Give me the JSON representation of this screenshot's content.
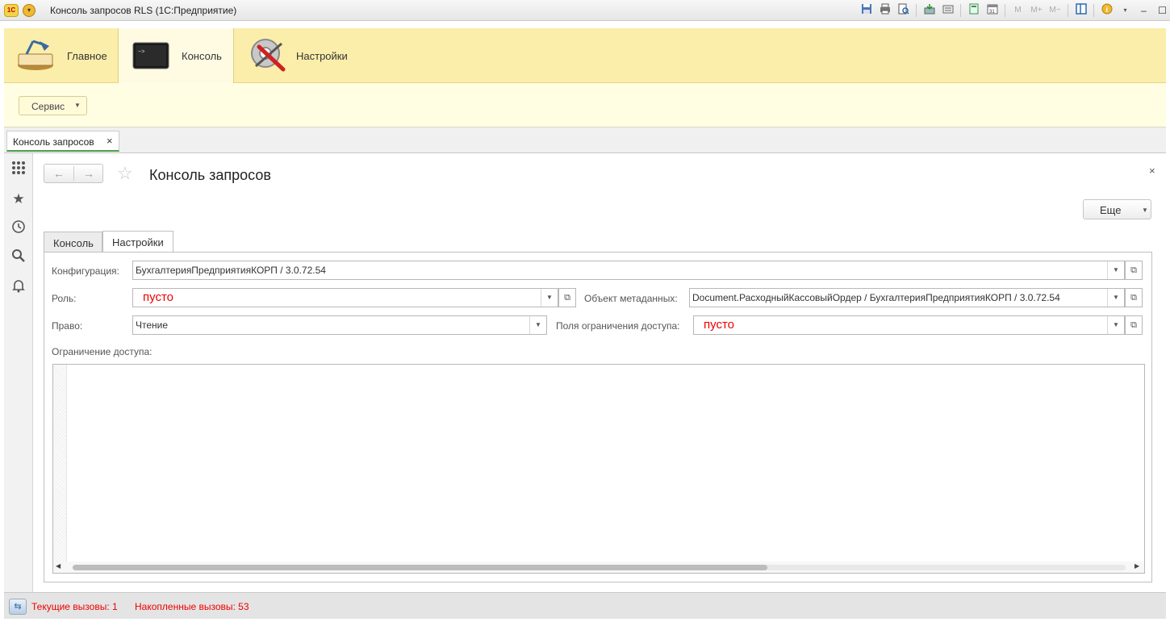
{
  "window": {
    "title": "Консоль запросов RLS  (1С:Предприятие)",
    "logo": "1С",
    "toolbar_icons": [
      "save-icon",
      "print-icon",
      "print-preview-icon",
      "attach-icon",
      "find-icon",
      "calculator-icon",
      "calendar-icon",
      "m-icon",
      "m-plus-icon",
      "m-minus-icon",
      "panels-icon",
      "info-icon",
      "menu-icon",
      "minimize-icon",
      "maximize-icon",
      "close-icon"
    ],
    "toolbar_gray": {
      "m": "M",
      "m_plus": "M+",
      "m_minus": "M−"
    }
  },
  "sections": [
    {
      "label": "Главное",
      "icon": "desk-lamp-icon"
    },
    {
      "label": "Консоль",
      "icon": "console-icon",
      "active": true
    },
    {
      "label": "Настройки",
      "icon": "settings-tools-icon"
    }
  ],
  "commands": {
    "service_label": "Сервис"
  },
  "open_windows": [
    {
      "label": "Консоль запросов",
      "close": "×"
    }
  ],
  "left_nav_icons": [
    "apps-grid-icon",
    "favorites-star-icon",
    "history-icon",
    "search-icon",
    "notifications-bell-icon"
  ],
  "form": {
    "title": "Консоль запросов",
    "close": "×",
    "more_label": "Еще",
    "tabs": [
      {
        "label": "Консоль",
        "active": false
      },
      {
        "label": "Настройки",
        "active": true
      }
    ],
    "fields": {
      "configuration": {
        "label": "Конфигурация:",
        "value": "БухгалтерияПредприятияКОРП / 3.0.72.54"
      },
      "role": {
        "label": "Роль:",
        "value": "пусто"
      },
      "metadata_object": {
        "label": "Объект метаданных:",
        "value": "Document.РасходныйКассовыйОрдер / БухгалтерияПредприятияКОРП / 3.0.72.54"
      },
      "right": {
        "label": "Право:",
        "value": "Чтение"
      },
      "restriction_fields": {
        "label": "Поля ограничения доступа:",
        "value": "пусто"
      },
      "access_restriction": {
        "label": "Ограничение доступа:",
        "value": ""
      }
    },
    "editor_scroll_position": 0.66
  },
  "status": {
    "current_calls": "Текущие вызовы: 1",
    "accumulated_calls": "Накопленные вызовы: 53",
    "text_color": "#e00000"
  },
  "colors": {
    "sections_bg": "#fbeeaa",
    "commands_bg": "#fffee3",
    "status_text": "#e00000",
    "active_tab_underline": "#4aa04a"
  }
}
